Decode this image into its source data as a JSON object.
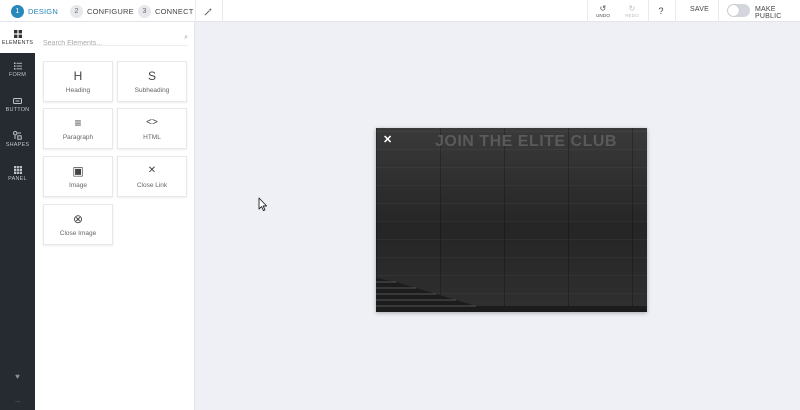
{
  "steps": [
    {
      "num": "1",
      "label": "DESIGN"
    },
    {
      "num": "2",
      "label": "CONFIGURE"
    },
    {
      "num": "3",
      "label": "CONNECT"
    }
  ],
  "toolbar": {
    "undo_label": "UNDO",
    "redo_label": "REDO",
    "help_label": "?",
    "save_label": "SAVE",
    "make_public_label": "MAKE PUBLIC",
    "make_public_on": false
  },
  "rail": [
    {
      "icon": "grid-icon",
      "label": "ELEMENTS"
    },
    {
      "icon": "form-icon",
      "label": "FORM"
    },
    {
      "icon": "button-icon",
      "label": "BUTTON"
    },
    {
      "icon": "shapes-icon",
      "label": "SHAPES"
    },
    {
      "icon": "panel-icon",
      "label": "PANEL"
    }
  ],
  "search": {
    "placeholder": "Search Elements..."
  },
  "elements": [
    {
      "glyph": "H",
      "label": "Heading"
    },
    {
      "glyph": "S",
      "label": "Subheading"
    },
    {
      "glyph": "≡",
      "label": "Paragraph"
    },
    {
      "glyph": "<>",
      "label": "HTML"
    },
    {
      "glyph": "▣",
      "label": "Image"
    },
    {
      "glyph": "✕",
      "label": "Close Link"
    },
    {
      "glyph": "⊗",
      "label": "Close Image"
    }
  ],
  "popup": {
    "headline": "JOIN THE ELITE CLUB",
    "close_glyph": "✕"
  },
  "colors": {
    "accent": "#2a87b9",
    "rail_bg": "#262a31",
    "canvas_bg": "#eef0f5"
  }
}
